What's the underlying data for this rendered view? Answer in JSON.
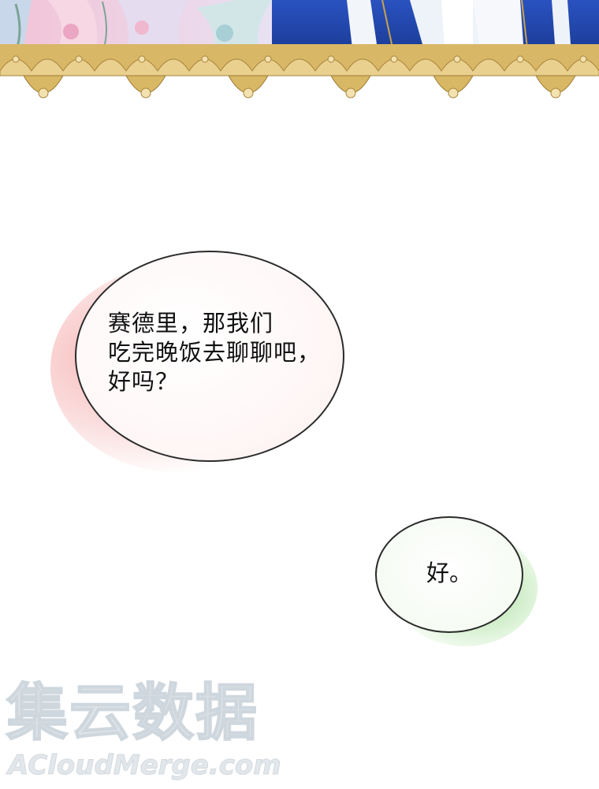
{
  "panel_1": {
    "illustration": "characters-with-gold-lace-border"
  },
  "bubble_1": {
    "lines": [
      "赛德里，那我们",
      "吃完晚饭去聊聊吧，",
      "好吗？"
    ]
  },
  "bubble_2": {
    "text": "好。"
  },
  "watermark": {
    "text_cn": "集云数据",
    "text_en": "ACloudMerge.com"
  },
  "colors": {
    "bubble_1_glow": "#f5aaaa",
    "bubble_2_glow": "#96d78c",
    "lace_gold": "#d4b262",
    "royal_blue": "#1f45a8"
  }
}
